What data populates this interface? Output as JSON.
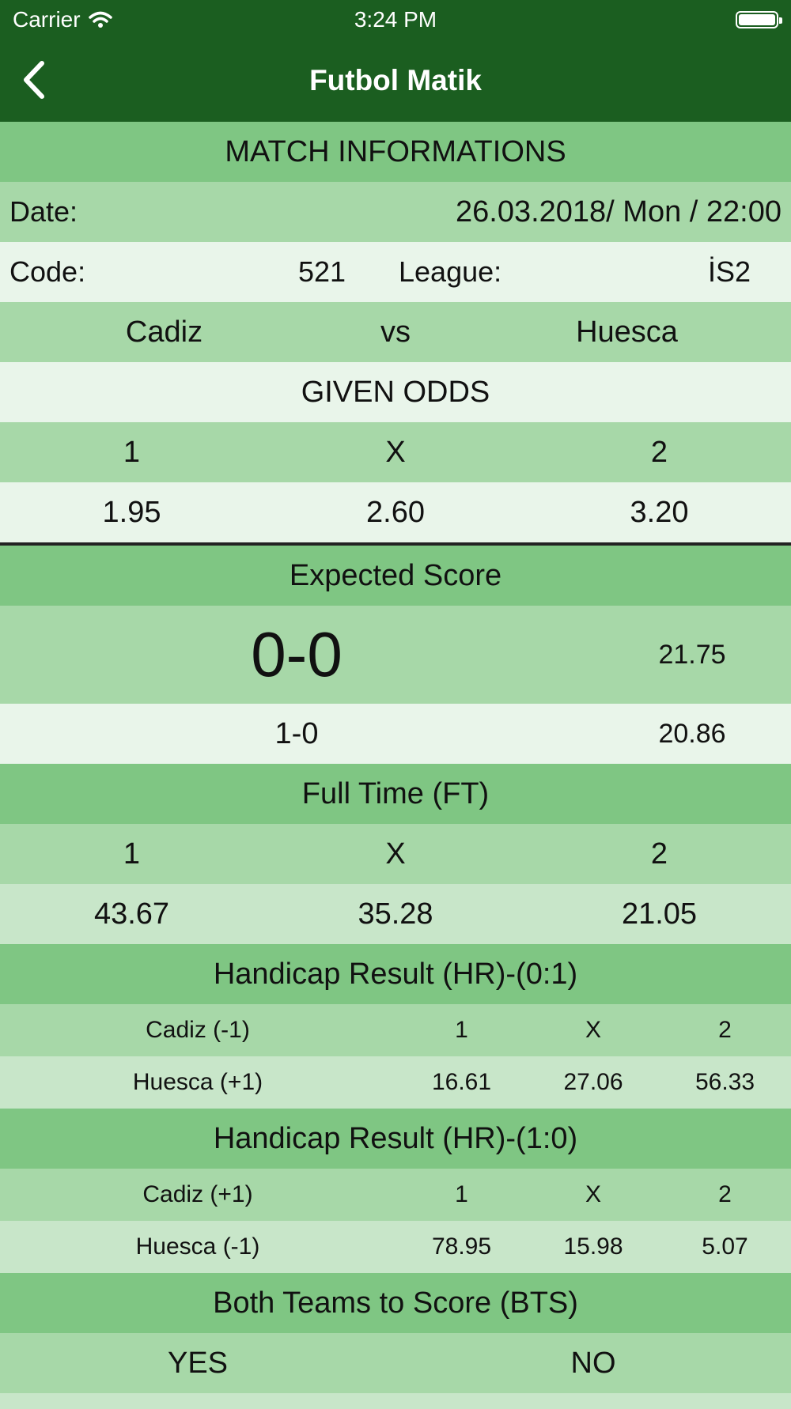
{
  "status_bar": {
    "carrier": "Carrier",
    "time": "3:24 PM"
  },
  "nav": {
    "title": "Futbol Matik"
  },
  "match_info": {
    "title": "MATCH INFORMATIONS",
    "date_label": "Date:",
    "date_value": "26.03.2018/ Mon / 22:00",
    "code_label": "Code:",
    "code_value": "521",
    "league_label": "League:",
    "league_value": "İS2",
    "home_team": "Cadiz",
    "vs": "vs",
    "away_team": "Huesca"
  },
  "given_odds": {
    "title": "GIVEN ODDS",
    "headers": [
      "1",
      "X",
      "2"
    ],
    "values": [
      "1.95",
      "2.60",
      "3.20"
    ]
  },
  "expected_score": {
    "title": "Expected Score",
    "primary_score": "0-0",
    "primary_value": "21.75",
    "secondary_score": "1-0",
    "secondary_value": "20.86"
  },
  "full_time": {
    "title": "Full Time (FT)",
    "headers": [
      "1",
      "X",
      "2"
    ],
    "values": [
      "43.67",
      "35.28",
      "21.05"
    ]
  },
  "handicap_01": {
    "title": "Handicap Result (HR)-(0:1)",
    "row1": [
      "Cadiz (-1)",
      "1",
      "X",
      "2"
    ],
    "row2": [
      "Huesca (+1)",
      "16.61",
      "27.06",
      "56.33"
    ]
  },
  "handicap_10": {
    "title": "Handicap Result (HR)-(1:0)",
    "row1": [
      "Cadiz (+1)",
      "1",
      "X",
      "2"
    ],
    "row2": [
      "Huesca (-1)",
      "78.95",
      "15.98",
      "5.07"
    ]
  },
  "bts": {
    "title": "Both Teams to Score (BTS)",
    "headers": [
      "YES",
      "NO"
    ]
  },
  "colors": {
    "nav_bg": "#1b5e20",
    "section_header": "#7fc683",
    "row_light": "#a7d8a8",
    "row_pale": "#e9f5ea",
    "row_soft": "#c8e6c9"
  }
}
